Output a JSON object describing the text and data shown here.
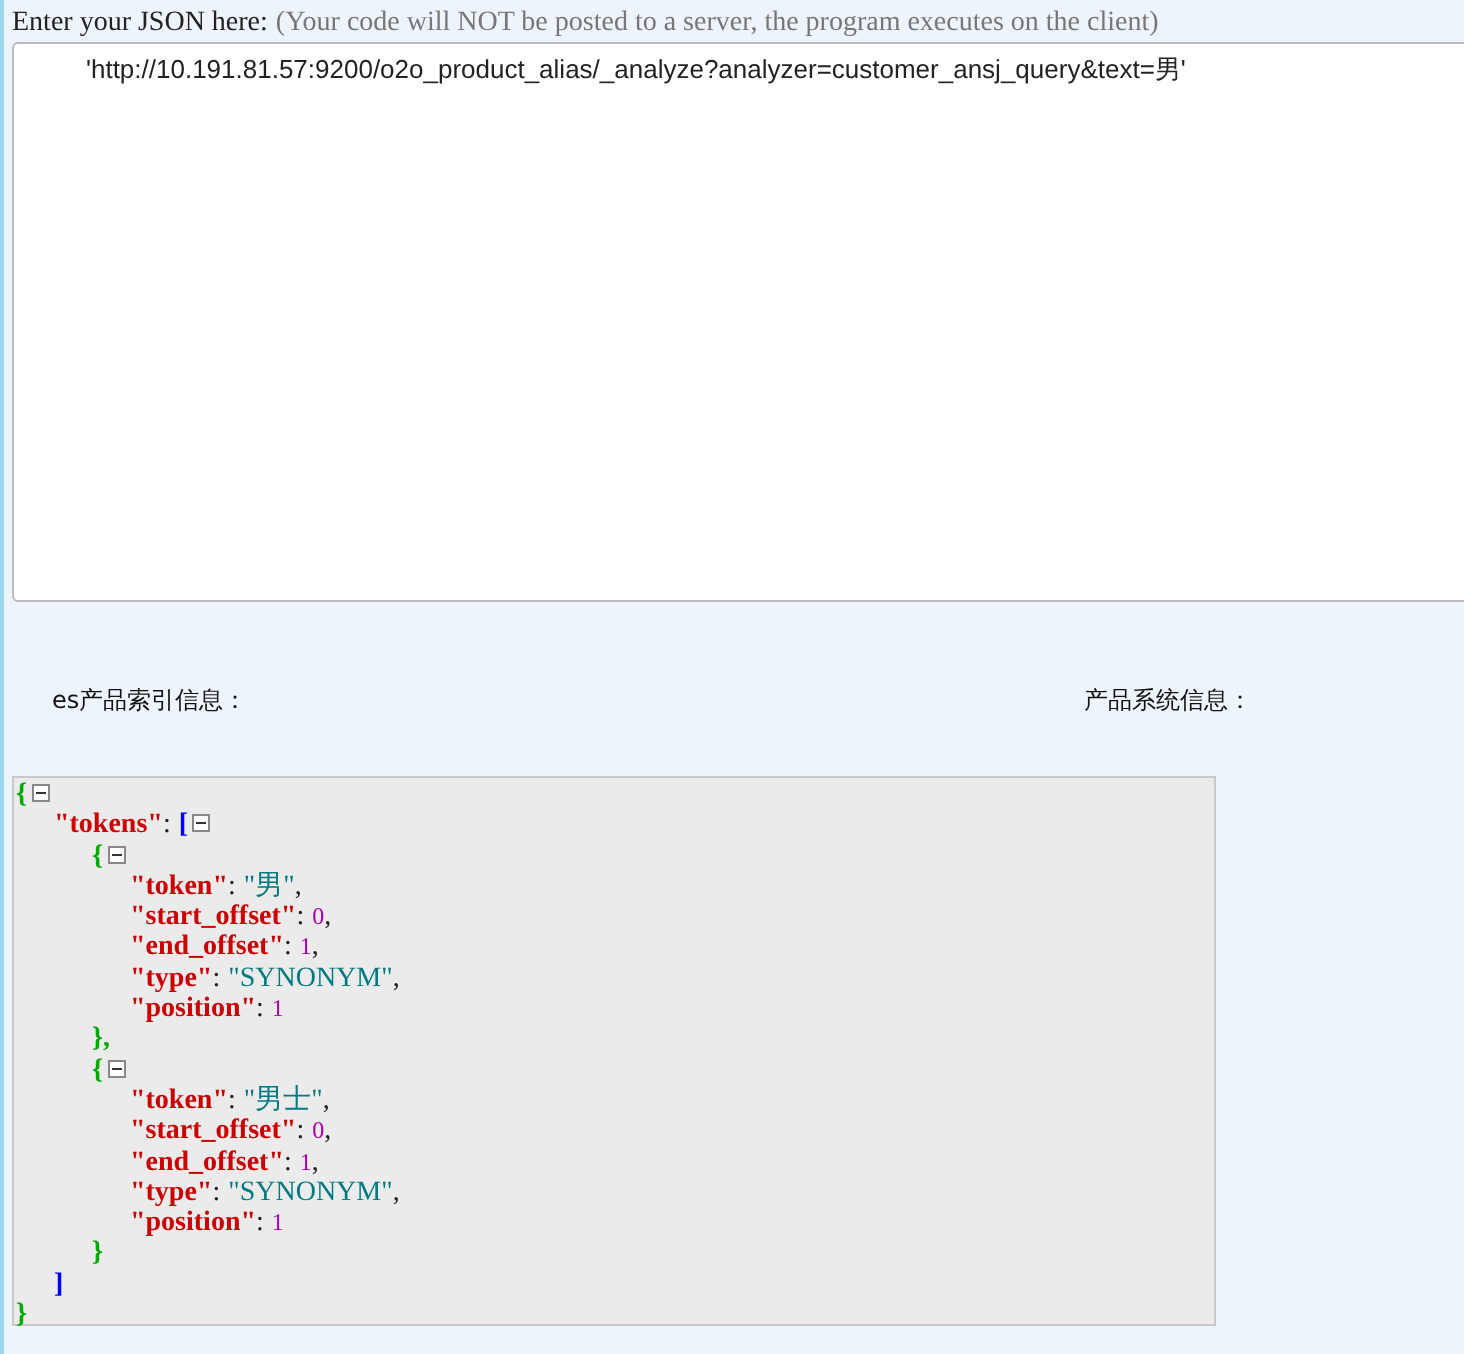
{
  "header": {
    "label": "Enter your JSON here:",
    "note": "(Your code will NOT be posted to a server, the program executes on the client)"
  },
  "input": {
    "value": "'http://10.191.81.57:9200/o2o_product_alias/_analyze?analyzer=customer_ansj_query&text=男'"
  },
  "sections": [
    {
      "label": "es产品索引信息："
    },
    {
      "label": "产品系统信息："
    }
  ],
  "viewer": {
    "open": "{",
    "close": "}",
    "expanded": true,
    "children": [
      {
        "key": "\"tokens\"",
        "colon": ":",
        "open": "[",
        "close": "]",
        "expanded": true,
        "items": [
          {
            "open": "{",
            "close": "},",
            "expanded": true,
            "fields": [
              {
                "key": "\"token\"",
                "colon": ":",
                "value": "\"男\"",
                "kind": "string",
                "comma": ","
              },
              {
                "key": "\"start_offset\"",
                "colon": ":",
                "value": "0",
                "kind": "number",
                "comma": ","
              },
              {
                "key": "\"end_offset\"",
                "colon": ":",
                "value": "1",
                "kind": "number",
                "comma": ","
              },
              {
                "key": "\"type\"",
                "colon": ":",
                "value": "\"SYNONYM\"",
                "kind": "string",
                "comma": ","
              },
              {
                "key": "\"position\"",
                "colon": ":",
                "value": "1",
                "kind": "number"
              }
            ]
          },
          {
            "open": "{",
            "close": "}",
            "expanded": true,
            "fields": [
              {
                "key": "\"token\"",
                "colon": ":",
                "value": "\"男士\"",
                "kind": "string",
                "comma": ","
              },
              {
                "key": "\"start_offset\"",
                "colon": ":",
                "value": "0",
                "kind": "number",
                "comma": ","
              },
              {
                "key": "\"end_offset\"",
                "colon": ":",
                "value": "1",
                "kind": "number",
                "comma": ","
              },
              {
                "key": "\"type\"",
                "colon": ":",
                "value": "\"SYNONYM\"",
                "kind": "string",
                "comma": ","
              },
              {
                "key": "\"position\"",
                "colon": ":",
                "value": "1",
                "kind": "number"
              }
            ]
          }
        ]
      }
    ]
  }
}
